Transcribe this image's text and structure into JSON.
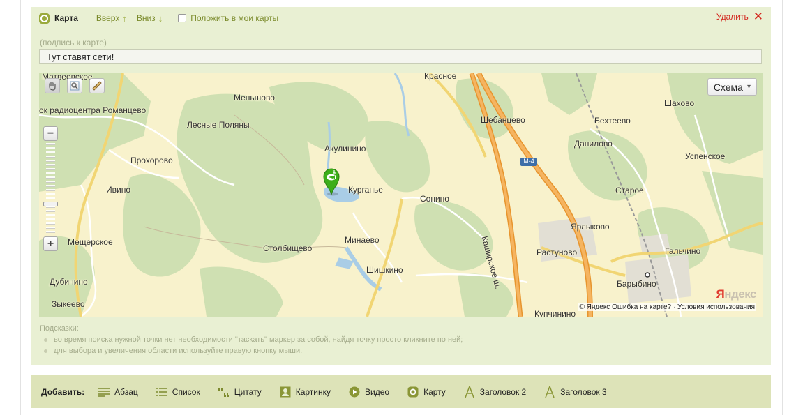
{
  "header": {
    "title": "Карта",
    "up_label": "Вверх",
    "up_arrow": "↑",
    "down_label": "Вниз",
    "down_arrow": "↓",
    "my_maps_label": "Положить в мои карты",
    "delete_label": "Удалить",
    "delete_glyph": "✕"
  },
  "caption": {
    "label": "(подпись к карте)",
    "value": "Тут ставят сети!"
  },
  "map": {
    "type_button": "Схема",
    "caret": "▾",
    "zoom_in": "+",
    "zoom_out": "−",
    "road_label": "Каширское ш.",
    "highway_badge": "M-4",
    "logo_prefix": "Я",
    "logo_rest": "ндекс",
    "copyright": "© Яндекс",
    "error_link": "Ошибка на карте?",
    "separator": "·",
    "terms_link": "Условия использования",
    "places": [
      "Матвеевское",
      "ок радиоцентра Романцево",
      "Меньшово",
      "Лесные Поляны",
      "Прохорово",
      "Ивино",
      "Мещерское",
      "Дубинино",
      "Зыкеево",
      "Красное",
      "Акулинино",
      "Курганье",
      "Сонино",
      "Минаево",
      "Столбищево",
      "Шишкино",
      "Шебанцево",
      "Бехтеево",
      "Данилово",
      "Шахово",
      "Успенское",
      "Старое",
      "Ярлыково",
      "Растуново",
      "Гальчино",
      "Барыбино",
      "Купчинино"
    ]
  },
  "hints": {
    "title": "Подсказки:",
    "items": [
      "во время поиска нужной точки нет необходимости \"таскать\" маркер за собой, найдя точку просто кликните по ней;",
      "для выбора и увеличения области используйте правую кнопку мыши."
    ]
  },
  "add_bar": {
    "label": "Добавить:",
    "items": [
      "Абзац",
      "Список",
      "Цитату",
      "Картинку",
      "Видео",
      "Карту",
      "Заголовок 2",
      "Заголовок 3"
    ]
  },
  "colors": {
    "panel": "#e9f0d3",
    "add_bar": "#dde3b8",
    "accent_green": "#9aaa3c",
    "delete_red": "#d3271e",
    "marker_green": "#3dae1a",
    "road_orange": "#f0a040"
  }
}
